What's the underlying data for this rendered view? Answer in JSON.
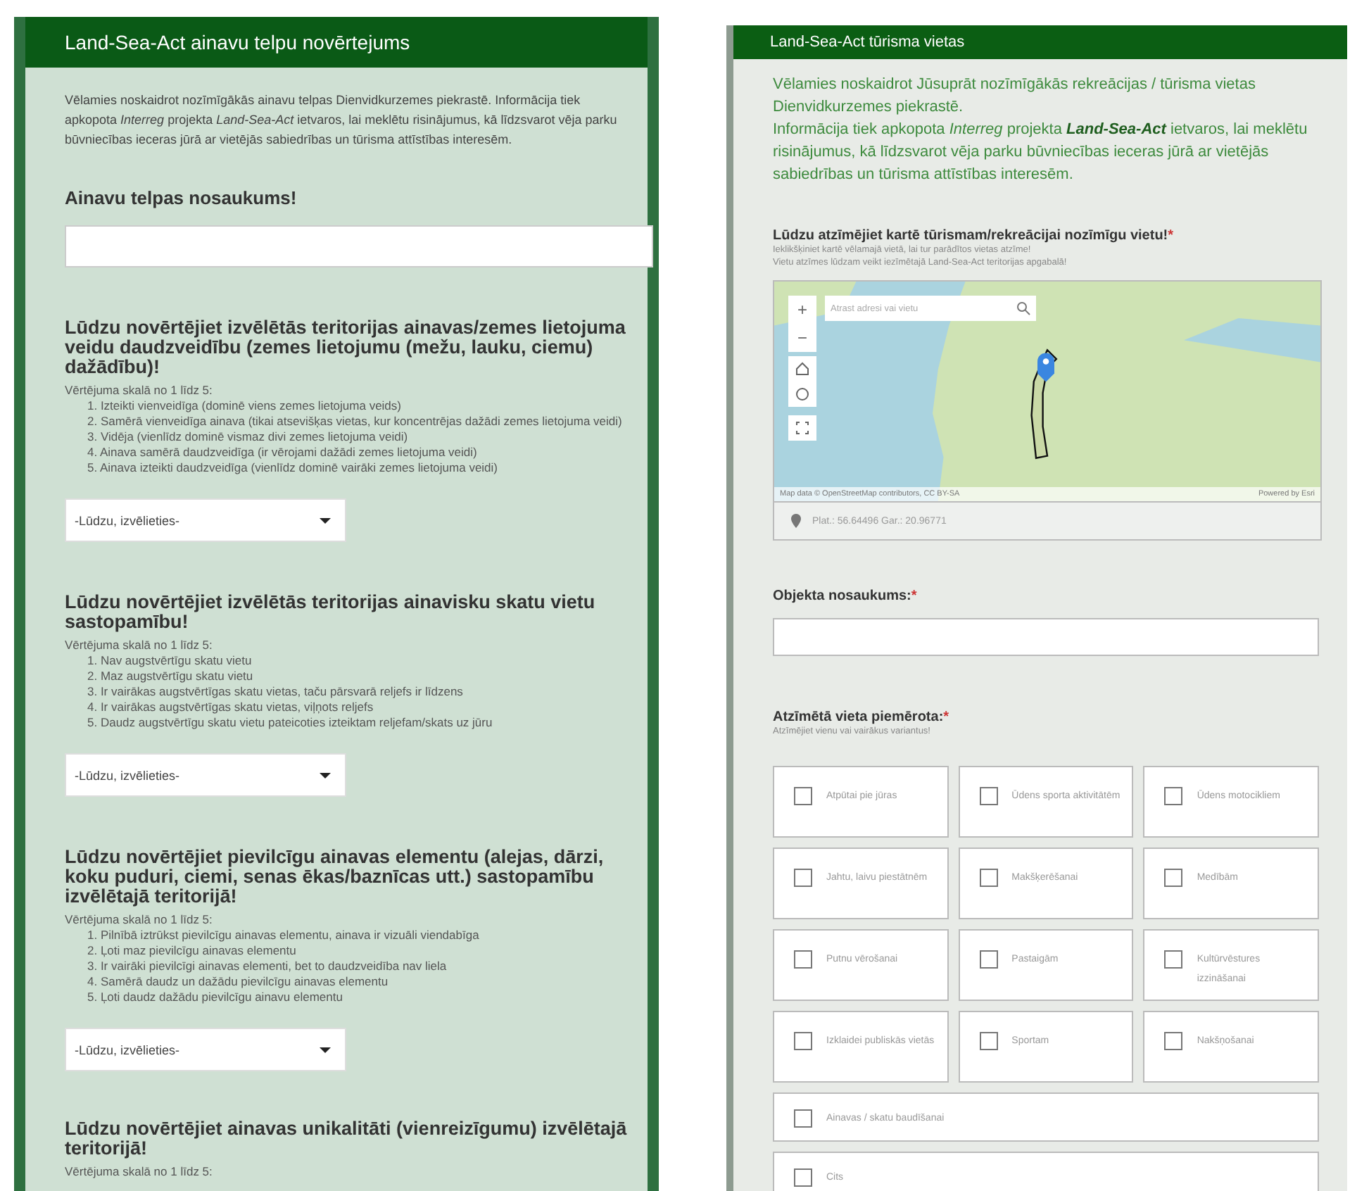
{
  "left_form": {
    "title": "Land-Sea-Act ainavu telpu novērtejums",
    "intro": "Vēlamies noskaidrot nozīmīgākās ainavu telpas Dienvidkurzemes piekrastē. Informācija tiek apkopota *Interreg* projekta *Land-Sea-Act* ietvaros, lai meklētu risinājumus, kā līdzsvarot vēja parku būvniecības ieceras jūrā ar vietējās sabiedrības un tūrisma attīstības interesēm.",
    "name_question": {
      "label": "Ainavu telpas nosaukums!"
    },
    "questions": [
      {
        "title": "Lūdzu novērtējiet izvēlētās teritorijas ainavas/zemes lietojuma veidu daudzveidību (zemes lietojumu (mežu, lauku, ciemu) dažādību)!",
        "scale_label": "Vērtējuma skalā no 1 līdz 5:",
        "options": [
          "1. Izteikti vienveidīga (dominē viens zemes lietojuma veids)",
          "2. Samērā vienveidīga ainava (tikai atsevišķas vietas, kur koncentrējas dažādi zemes lietojuma veidi)",
          "3. Vidēja (vienlīdz dominē vismaz divi zemes lietojuma veidi)",
          "4. Ainava samērā daudzveidīga (ir vērojami dažādi zemes lietojuma veidi)",
          "5. Ainava izteikti daudzveidīga (vienlīdz dominē vairāki zemes lietojuma veidi)"
        ],
        "dropdown": {
          "placeholder": "-Lūdzu, izvēlieties-"
        }
      },
      {
        "title": "Lūdzu novērtējiet izvēlētās teritorijas ainavisku skatu vietu sastopamību!",
        "scale_label": "Vērtējuma skalā no 1 līdz 5:",
        "options": [
          "1. Nav augstvērtīgu skatu vietu",
          "2. Maz augstvērtīgu skatu vietu",
          "3. Ir vairākas augstvērtīgas skatu vietas, taču pārsvarā reljefs ir līdzens",
          "4. Ir vairākas augstvērtīgas skatu vietas, viļņots reljefs",
          "5. Daudz augstvērtīgu skatu vietu pateicoties izteiktam reljefam/skats uz jūru"
        ],
        "dropdown": {
          "placeholder": "-Lūdzu, izvēlieties-"
        }
      },
      {
        "title": "Lūdzu novērtējiet pievilcīgu ainavas elementu (alejas, dārzi, koku puduri, ciemi, senas ēkas/baznīcas utt.) sastopamību izvēlētajā teritorijā!",
        "scale_label": "Vērtējuma skalā no 1 līdz 5:",
        "options": [
          "1. Pilnībā iztrūkst pievilcīgu ainavas elementu, ainava ir vizuāli viendabīga",
          "2. Ļoti maz pievilcīgu ainavas elementu",
          "3. Ir vairāki pievilcīgi ainavas elementi, bet to daudzveidība nav liela",
          "4. Samērā daudz un dažādu pievilcīgu ainavas elementu",
          "5. Ļoti daudz dažādu pievilcīgu ainavu elementu"
        ],
        "dropdown": {
          "placeholder": "-Lūdzu, izvēlieties-"
        }
      },
      {
        "title": "Lūdzu novērtējiet ainavas unikalitāti (vienreizīgumu) izvēlētajā teritorijā!",
        "scale_label": "Vērtējuma skalā no 1 līdz 5:"
      }
    ]
  },
  "right_form": {
    "title": "Land-Sea-Act tūrisma vietas",
    "intro": [
      "Vēlamies noskaidrot Jūsuprāt nozīmīgākās rekreācijas / tūrisma vietas Dienvidkurzemes piekrastē.",
      "Informācija tiek apkopota *Interreg* projekta **Land-Sea-Act** ietvaros, lai meklētu risinājumus, kā līdzsvarot vēja parku būvniecības ieceras jūrā ar vietējās sabiedrības un tūrisma attīstības interesēm."
    ],
    "map_question": {
      "label": "Lūdzu atzīmējiet kartē tūrismam/rekreācijai nozīmīgu vietu!",
      "required_mark": "*",
      "hints": [
        "Ieklikšķiniet kartē vēlamajā vietā, lai tur parādītos vietas atzīme!",
        "Vietu atzīmes lūdzam veikt iezīmētajā Land-Sea-Act teritorijas apgabalā!"
      ],
      "map": {
        "zoom_in": "+",
        "zoom_out": "−",
        "search_placeholder": "Atrast adresi vai vietu",
        "attribution": "Map data © OpenStreetMap contributors, CC BY-SA",
        "powered_by": "Powered by Esri",
        "coordinates": "Plat.: 56.64496  Gar.: 20.96771"
      }
    },
    "name_question": {
      "label": "Objekta nosaukums:",
      "required_mark": "*"
    },
    "suitability": {
      "label": "Atzīmētā vieta piemērota:",
      "required_mark": "*",
      "hint": "Atzīmējiet vienu vai vairākus variantus!",
      "options": [
        {
          "label": "Atpūtai pie jūras",
          "checked": false,
          "kind": "grid"
        },
        {
          "label": "Ūdens sporta aktivitātēm",
          "checked": false,
          "kind": "grid"
        },
        {
          "label": "Ūdens motocikliem",
          "checked": false,
          "kind": "grid"
        },
        {
          "label": "Jahtu, laivu piestātnēm",
          "checked": false,
          "kind": "grid"
        },
        {
          "label": "Makšķerēšanai",
          "checked": false,
          "kind": "grid"
        },
        {
          "label": "Medībām",
          "checked": false,
          "kind": "grid"
        },
        {
          "label": "Putnu vērošanai",
          "checked": false,
          "kind": "grid"
        },
        {
          "label": "Pastaigām",
          "checked": false,
          "kind": "grid"
        },
        {
          "label": "Kultūrvēstures izzināšanai",
          "checked": false,
          "kind": "grid"
        },
        {
          "label": "Izklaidei publiskās vietās",
          "checked": false,
          "kind": "grid"
        },
        {
          "label": "Sportam",
          "checked": false,
          "kind": "grid"
        },
        {
          "label": "Nakšņošanai",
          "checked": false,
          "kind": "grid"
        },
        {
          "label": "Ainavas / skatu baudīšanai",
          "checked": false,
          "kind": "wide"
        },
        {
          "label": "Cits",
          "checked": false,
          "kind": "wide"
        }
      ]
    }
  }
}
